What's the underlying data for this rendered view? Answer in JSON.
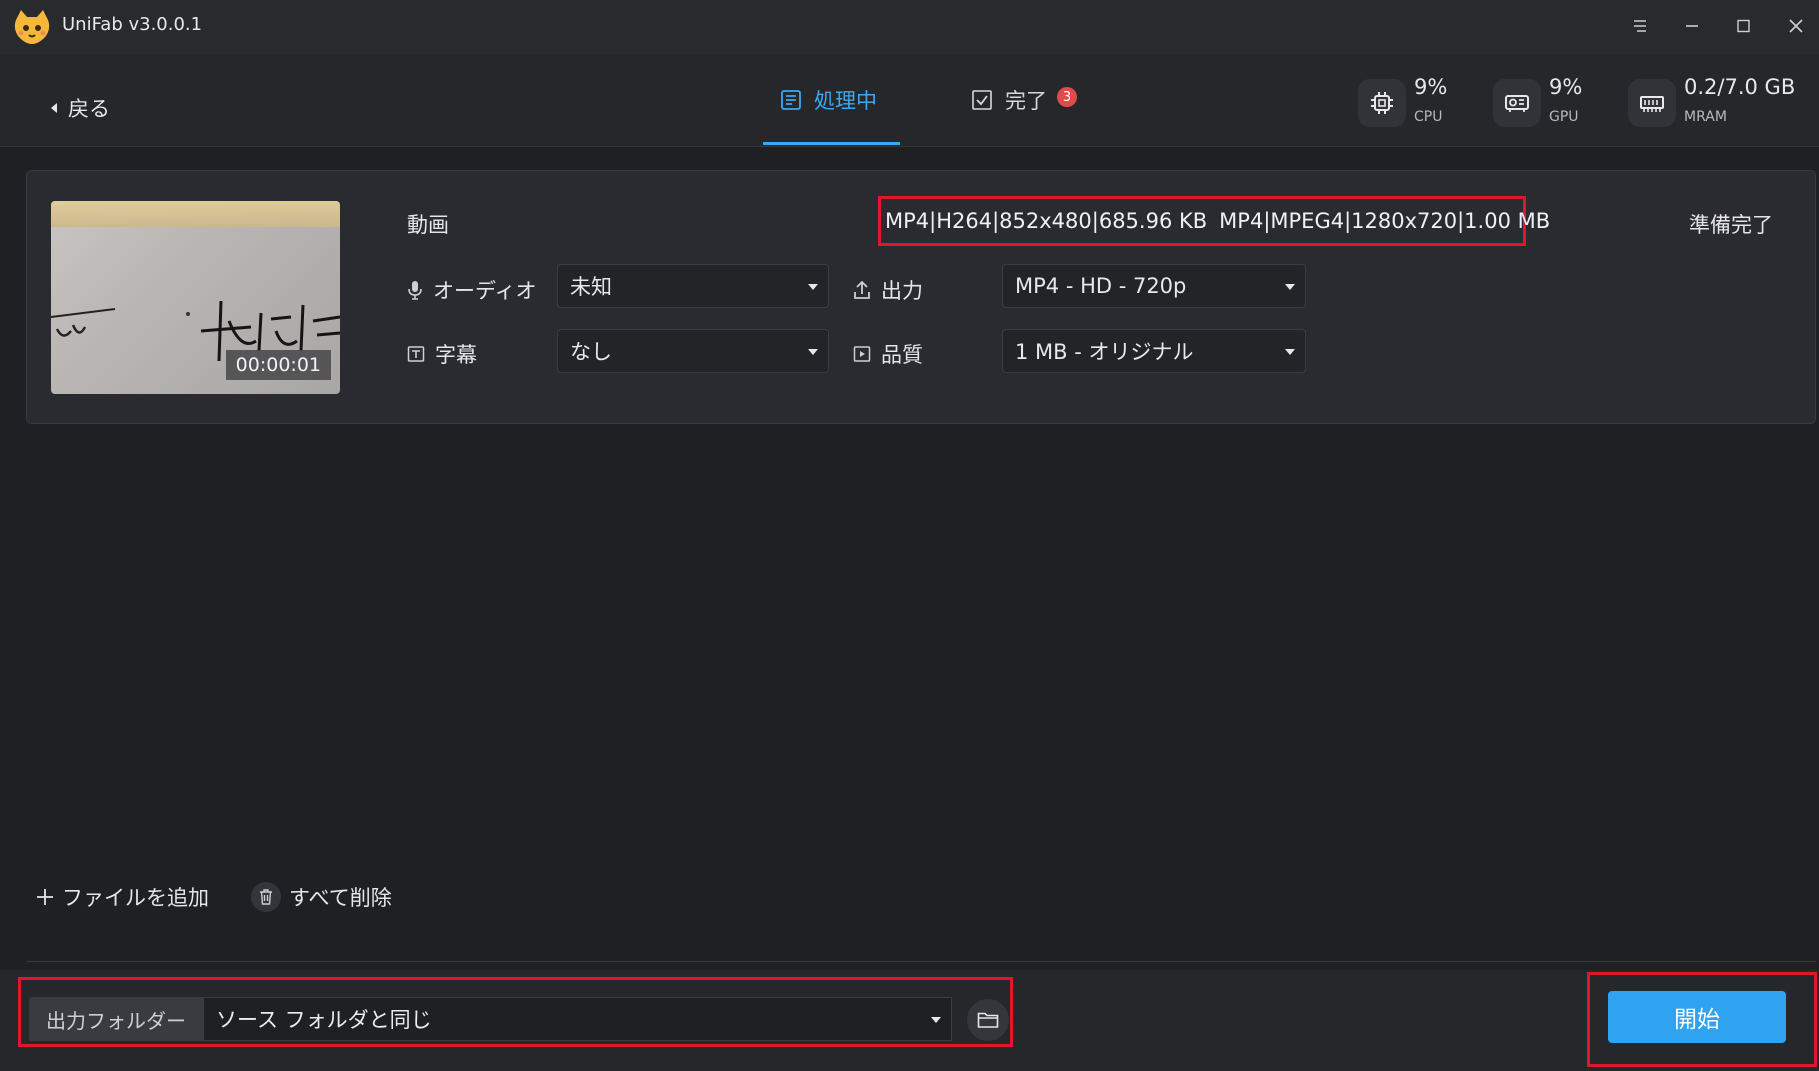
{
  "app": {
    "title": "UniFab v3.0.0.1"
  },
  "window_controls": [
    "menu-icon",
    "minimize-icon",
    "maximize-icon",
    "close-icon"
  ],
  "header": {
    "back_label": "戻る",
    "tabs": [
      {
        "label": "処理中",
        "active": true
      },
      {
        "label": "完了",
        "badge": "3"
      }
    ],
    "stats": [
      {
        "value": "9%",
        "label": "CPU",
        "icon": "cpu-icon"
      },
      {
        "value": "9%",
        "label": "GPU",
        "icon": "gpu-icon"
      },
      {
        "value": "0.2/7.0 GB",
        "label": "MRAM",
        "icon": "memory-icon"
      }
    ]
  },
  "task": {
    "duration": "00:00:01",
    "video_label": "動画",
    "source_format": "MP4|H264|852x480|685.96 KB",
    "target_format": "MP4|MPEG4|1280x720|1.00 MB",
    "status": "準備完了",
    "audio_label": "オーディオ",
    "audio_value": "未知",
    "subtitle_label": "字幕",
    "subtitle_value": "なし",
    "output_label": "出力",
    "output_value": "MP4 - HD - 720p",
    "quality_label": "品質",
    "quality_value": "1 MB - オリジナル"
  },
  "actions": {
    "add_file": "ファイルを追加",
    "delete_all": "すべて削除"
  },
  "footer": {
    "output_folder_label": "出力フォルダー",
    "output_folder_value": "ソース フォルダと同じ",
    "start_label": "開始"
  },
  "colors": {
    "accent": "#3aa9f2",
    "highlight": "#e0162b",
    "badge": "#e24a4a",
    "start": "#2fa3ef"
  }
}
